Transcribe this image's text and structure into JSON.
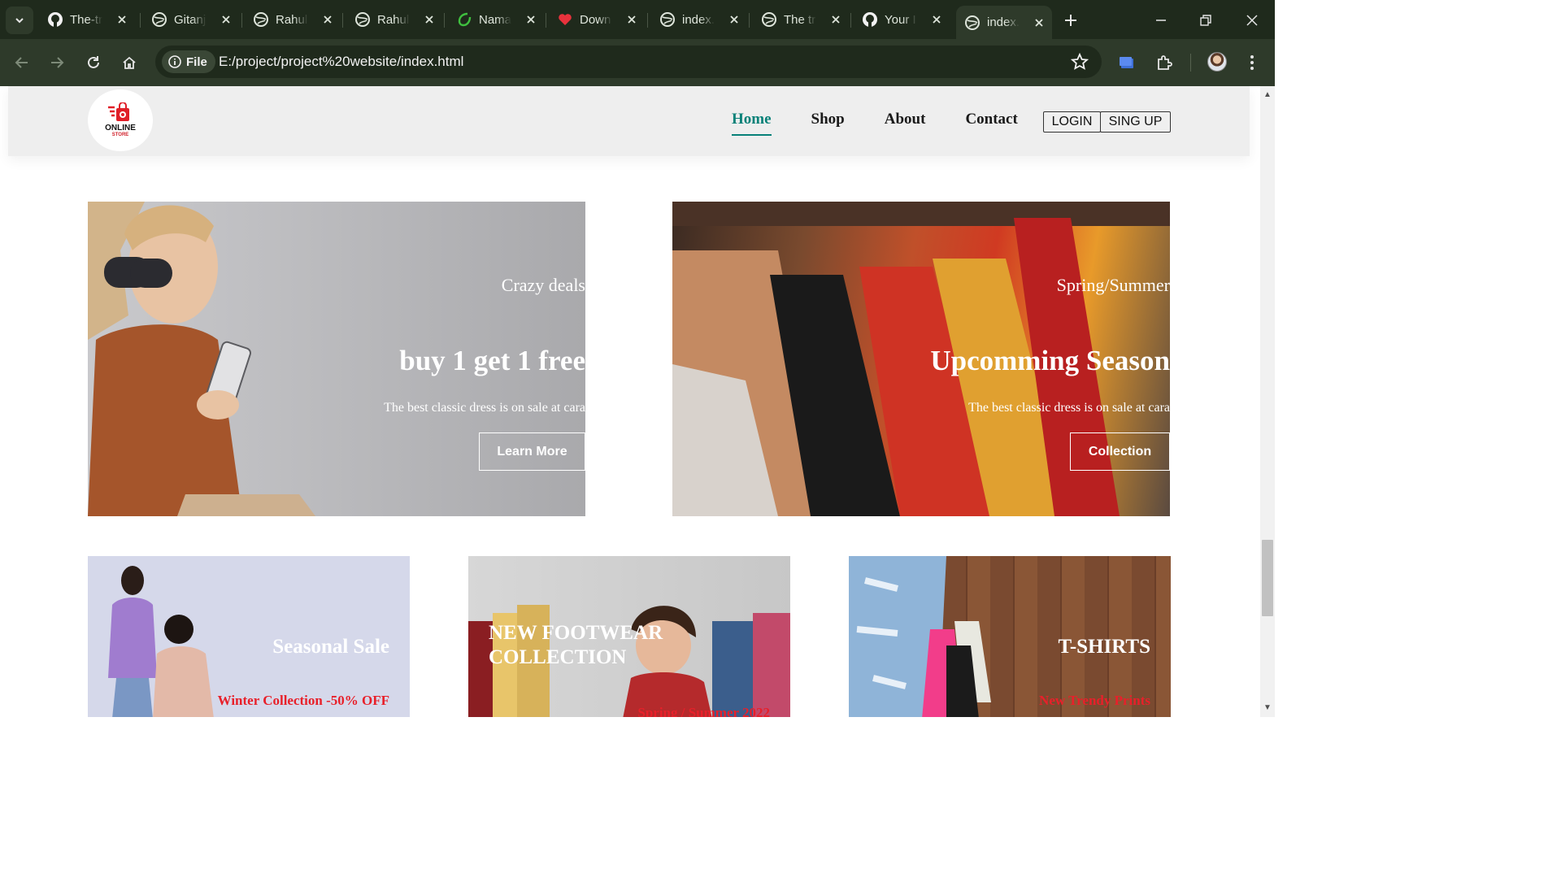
{
  "browser": {
    "tabs": [
      {
        "title": "The-tr",
        "icon": "github-icon"
      },
      {
        "title": "Gitanj",
        "icon": "globe-icon"
      },
      {
        "title": "Rahul",
        "icon": "globe-icon"
      },
      {
        "title": "Rahul",
        "icon": "globe-icon"
      },
      {
        "title": "Nama",
        "icon": "leaf-icon"
      },
      {
        "title": "Down",
        "icon": "heart-icon"
      },
      {
        "title": "index.",
        "icon": "globe-icon"
      },
      {
        "title": "The tr",
        "icon": "globe-icon"
      },
      {
        "title": "Your I",
        "icon": "github-icon"
      },
      {
        "title": "index.",
        "icon": "globe-icon",
        "active": true
      }
    ],
    "address": {
      "scheme_chip": "File",
      "url": "E:/project/project%20website/index.html"
    },
    "colors": {
      "frame": "#1f2a1c",
      "toolbar": "#2e3a2a"
    }
  },
  "site": {
    "logo": {
      "line1": "ONLINE",
      "line2": "STORE"
    },
    "nav": [
      "Home",
      "Shop",
      "About",
      "Contact"
    ],
    "active_nav": "Home",
    "auth": {
      "login": "LOGIN",
      "signup": "SING UP"
    },
    "accent": "#088178",
    "banners": [
      {
        "subtitle": "Crazy deals",
        "headline": "buy 1 get 1 free",
        "text": "The best classic dress is on sale at cara",
        "button": "Learn More"
      },
      {
        "subtitle": "Spring/Summer",
        "headline": "Upcomming Season",
        "text": "The best classic dress is on sale at cara",
        "button": "Collection"
      }
    ],
    "cards": [
      {
        "title": "Seasonal Sale",
        "subtitle": "Winter Collection -50% OFF"
      },
      {
        "title": "NEW FOOTWEAR COLLECTION",
        "subtitle": "Spring / Summer 2022"
      },
      {
        "title": "T-SHIRTS",
        "subtitle": "New Trendy Prints"
      }
    ]
  }
}
